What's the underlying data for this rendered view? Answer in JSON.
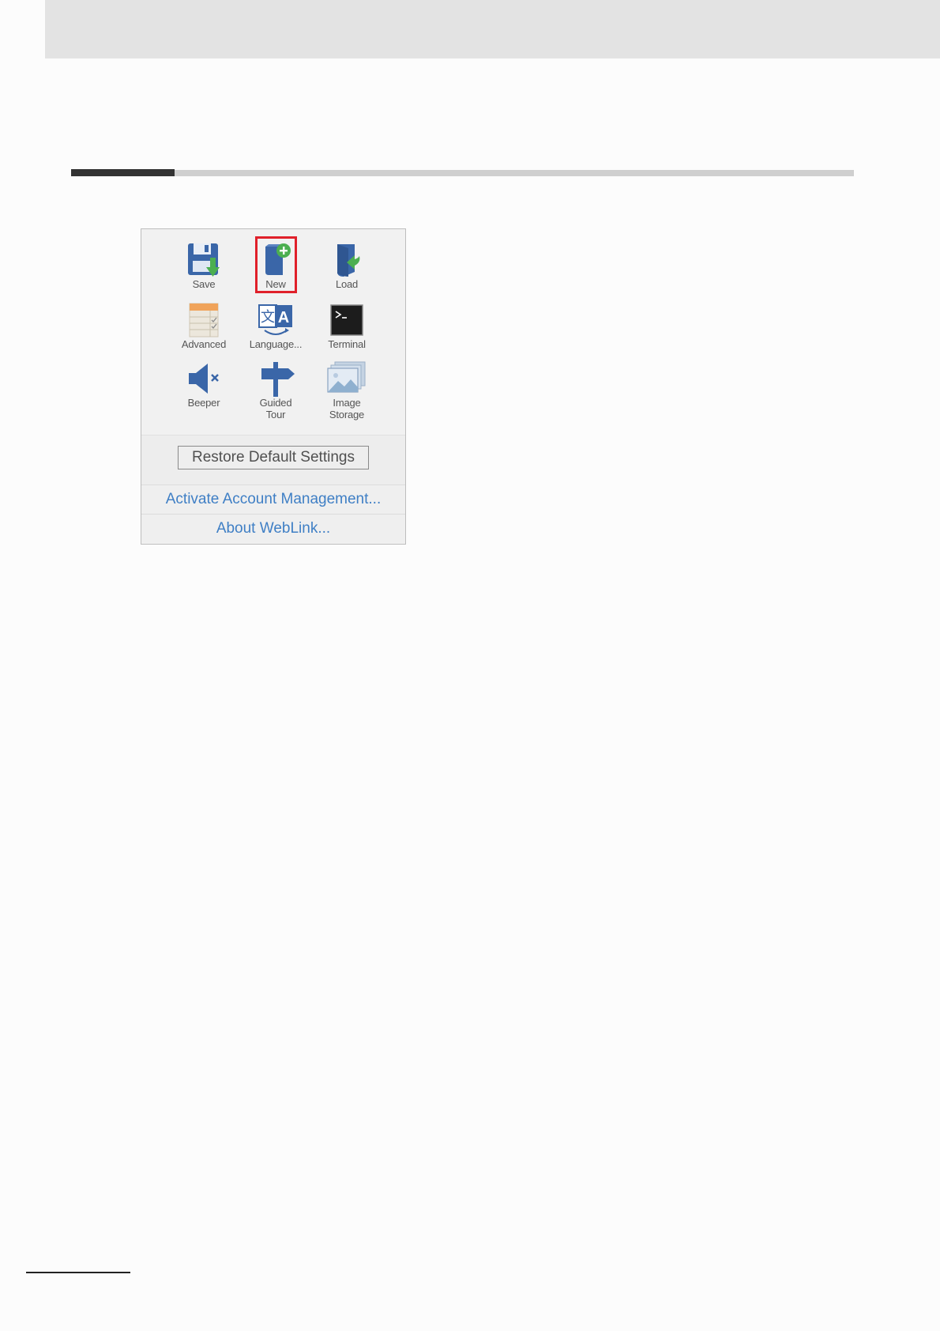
{
  "menu": {
    "tiles": [
      {
        "label": "Save",
        "icon": "save-icon"
      },
      {
        "label": "New",
        "icon": "new-document-icon"
      },
      {
        "label": "Load",
        "icon": "load-icon"
      },
      {
        "label": "Advanced",
        "icon": "advanced-icon"
      },
      {
        "label": "Language...",
        "icon": "language-icon"
      },
      {
        "label": "Terminal",
        "icon": "terminal-icon"
      },
      {
        "label": "Beeper",
        "icon": "beeper-muted-icon"
      },
      {
        "label_line1": "Guided",
        "label_line2": "Tour",
        "icon": "signpost-icon"
      },
      {
        "label_line1": "Image",
        "label_line2": "Storage",
        "icon": "image-storage-icon"
      }
    ],
    "restore_label": "Restore Default Settings",
    "activate_label": "Activate Account Management...",
    "about_label": "About WebLink...",
    "highlighted_item": "New",
    "colors": {
      "highlight": "#e0202a",
      "link": "#3f7fc5",
      "icon_blue": "#3a66a8",
      "icon_green": "#4caf50"
    }
  }
}
